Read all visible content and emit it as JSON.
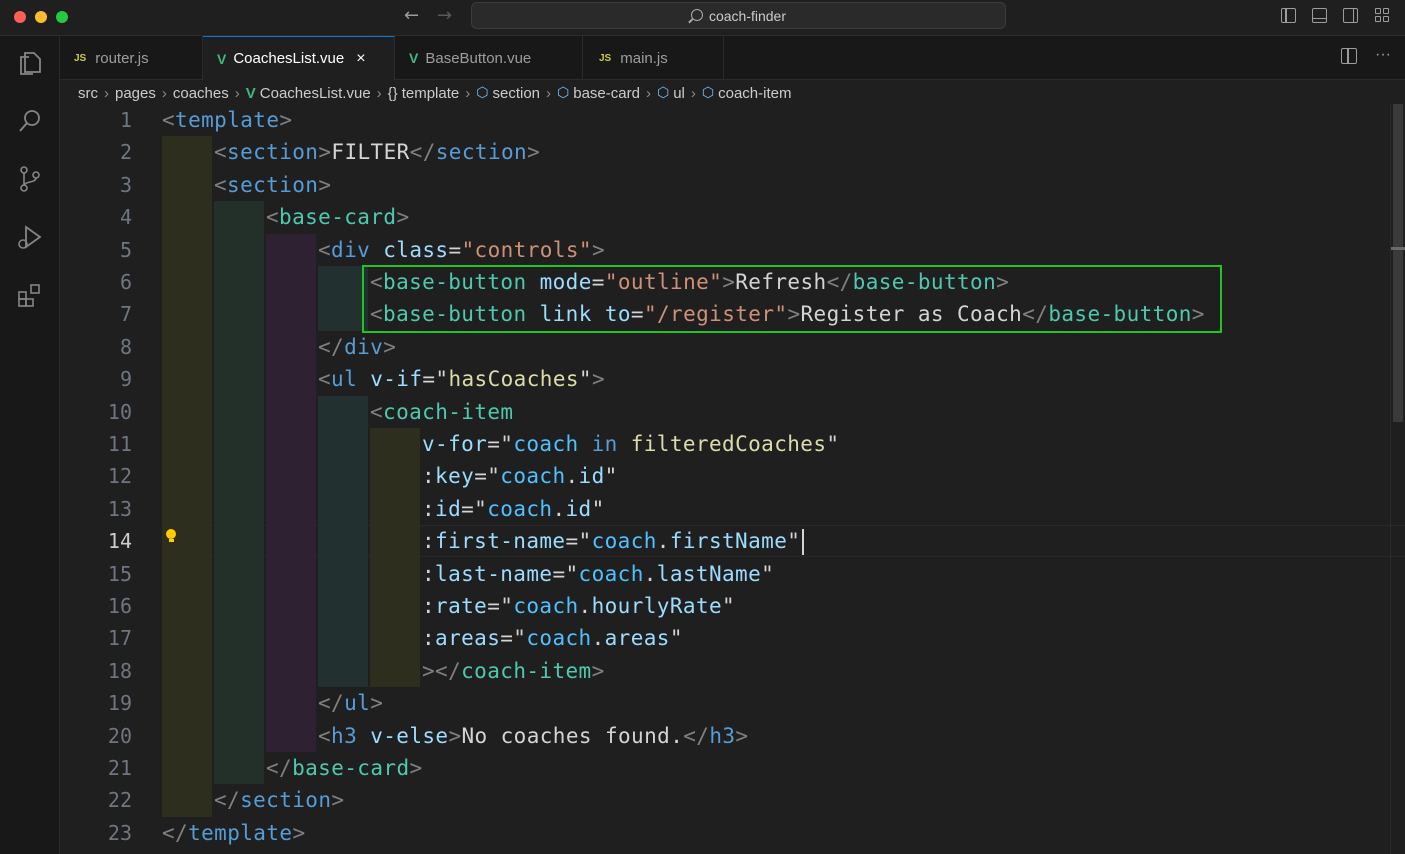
{
  "window": {
    "search_label": "coach-finder",
    "nav_back": "←",
    "nav_forward": "→"
  },
  "tabs": [
    {
      "icon": "JS",
      "label": "router.js"
    },
    {
      "icon": "V",
      "label": "CoachesList.vue",
      "active": true,
      "close": "×"
    },
    {
      "icon": "V",
      "label": "BaseButton.vue"
    },
    {
      "icon": "JS",
      "label": "main.js"
    }
  ],
  "tab_actions": {
    "more": "···"
  },
  "breadcrumb": [
    "src",
    "pages",
    "coaches",
    "CoachesList.vue",
    "template",
    "section",
    "base-card",
    "ul",
    "coach-item"
  ],
  "breadcrumb_template_icon": "{}",
  "editor": {
    "line_numbers": [
      "1",
      "2",
      "3",
      "4",
      "5",
      "6",
      "7",
      "8",
      "9",
      "10",
      "11",
      "12",
      "13",
      "14",
      "15",
      "16",
      "17",
      "18",
      "19",
      "20",
      "21",
      "22",
      "23"
    ],
    "current_line": "14",
    "lines": [
      [
        [
          "p",
          "<"
        ],
        [
          "t",
          "template"
        ],
        [
          "p",
          ">"
        ]
      ],
      [
        [
          "p",
          "<"
        ],
        [
          "t",
          "section"
        ],
        [
          "p",
          ">"
        ],
        [
          "x",
          "FILTER"
        ],
        [
          "p",
          "</"
        ],
        [
          "t",
          "section"
        ],
        [
          "p",
          ">"
        ]
      ],
      [
        [
          "p",
          "<"
        ],
        [
          "t",
          "section"
        ],
        [
          "p",
          ">"
        ]
      ],
      [
        [
          "p",
          "<"
        ],
        [
          "c",
          "base-card"
        ],
        [
          "p",
          ">"
        ]
      ],
      [
        [
          "p",
          "<"
        ],
        [
          "t",
          "div"
        ],
        [
          "x",
          " "
        ],
        [
          "a",
          "class"
        ],
        [
          "x",
          "="
        ],
        [
          "s",
          "\"controls\""
        ],
        [
          "p",
          ">"
        ]
      ],
      [
        [
          "p",
          "<"
        ],
        [
          "c",
          "base-button"
        ],
        [
          "x",
          " "
        ],
        [
          "a",
          "mode"
        ],
        [
          "x",
          "="
        ],
        [
          "s",
          "\"outline\""
        ],
        [
          "p",
          ">"
        ],
        [
          "x",
          "Refresh"
        ],
        [
          "p",
          "</"
        ],
        [
          "c",
          "base-button"
        ],
        [
          "p",
          ">"
        ]
      ],
      [
        [
          "p",
          "<"
        ],
        [
          "c",
          "base-button"
        ],
        [
          "x",
          " "
        ],
        [
          "a",
          "link"
        ],
        [
          "x",
          " "
        ],
        [
          "a",
          "to"
        ],
        [
          "x",
          "="
        ],
        [
          "s",
          "\"/register\""
        ],
        [
          "p",
          ">"
        ],
        [
          "x",
          "Register as Coach"
        ],
        [
          "p",
          "</"
        ],
        [
          "c",
          "base-button"
        ],
        [
          "p",
          ">"
        ]
      ],
      [
        [
          "p",
          "</"
        ],
        [
          "t",
          "div"
        ],
        [
          "p",
          ">"
        ]
      ],
      [
        [
          "p",
          "<"
        ],
        [
          "t",
          "ul"
        ],
        [
          "x",
          " "
        ],
        [
          "a",
          "v-if"
        ],
        [
          "x",
          "="
        ],
        [
          "x",
          "\""
        ],
        [
          "y",
          "hasCoaches"
        ],
        [
          "x",
          "\""
        ],
        [
          "p",
          ">"
        ]
      ],
      [
        [
          "p",
          "<"
        ],
        [
          "c",
          "coach-item"
        ]
      ],
      [
        [
          "a",
          "v-for"
        ],
        [
          "x",
          "=\""
        ],
        [
          "v",
          "coach"
        ],
        [
          "x",
          " "
        ],
        [
          "kw",
          "in"
        ],
        [
          "x",
          " "
        ],
        [
          "y",
          "filteredCoaches"
        ],
        [
          "x",
          "\""
        ]
      ],
      [
        [
          "x",
          ":"
        ],
        [
          "a",
          "key"
        ],
        [
          "x",
          "=\""
        ],
        [
          "v",
          "coach"
        ],
        [
          "x",
          "."
        ],
        [
          "a",
          "id"
        ],
        [
          "x",
          "\""
        ]
      ],
      [
        [
          "x",
          ":"
        ],
        [
          "a",
          "id"
        ],
        [
          "x",
          "=\""
        ],
        [
          "v",
          "coach"
        ],
        [
          "x",
          "."
        ],
        [
          "a",
          "id"
        ],
        [
          "x",
          "\""
        ]
      ],
      [
        [
          "x",
          ":"
        ],
        [
          "a",
          "first-name"
        ],
        [
          "x",
          "=\""
        ],
        [
          "v",
          "coach"
        ],
        [
          "x",
          "."
        ],
        [
          "a",
          "firstName"
        ],
        [
          "x",
          "\""
        ]
      ],
      [
        [
          "x",
          ":"
        ],
        [
          "a",
          "last-name"
        ],
        [
          "x",
          "=\""
        ],
        [
          "v",
          "coach"
        ],
        [
          "x",
          "."
        ],
        [
          "a",
          "lastName"
        ],
        [
          "x",
          "\""
        ]
      ],
      [
        [
          "x",
          ":"
        ],
        [
          "a",
          "rate"
        ],
        [
          "x",
          "=\""
        ],
        [
          "v",
          "coach"
        ],
        [
          "x",
          "."
        ],
        [
          "a",
          "hourlyRate"
        ],
        [
          "x",
          "\""
        ]
      ],
      [
        [
          "x",
          ":"
        ],
        [
          "a",
          "areas"
        ],
        [
          "x",
          "=\""
        ],
        [
          "v",
          "coach"
        ],
        [
          "x",
          "."
        ],
        [
          "a",
          "areas"
        ],
        [
          "x",
          "\""
        ]
      ],
      [
        [
          "p",
          "></"
        ],
        [
          "c",
          "coach-item"
        ],
        [
          "p",
          ">"
        ]
      ],
      [
        [
          "p",
          "</"
        ],
        [
          "t",
          "ul"
        ],
        [
          "p",
          ">"
        ]
      ],
      [
        [
          "p",
          "<"
        ],
        [
          "t",
          "h3"
        ],
        [
          "x",
          " "
        ],
        [
          "a",
          "v-else"
        ],
        [
          "p",
          ">"
        ],
        [
          "x",
          "No coaches found."
        ],
        [
          "p",
          "</"
        ],
        [
          "t",
          "h3"
        ],
        [
          "p",
          ">"
        ]
      ],
      [
        [
          "p",
          "</"
        ],
        [
          "c",
          "base-card"
        ],
        [
          "p",
          ">"
        ]
      ],
      [
        [
          "p",
          "</"
        ],
        [
          "t",
          "section"
        ],
        [
          "p",
          ">"
        ]
      ],
      [
        [
          "p",
          "</"
        ],
        [
          "t",
          "template"
        ],
        [
          "p",
          ">"
        ]
      ]
    ]
  },
  "colors": {
    "accent": "#0078d4",
    "highlight_box": "#22c322",
    "indent_guides": [
      "#2e2e1f",
      "#23302a",
      "#2e2232",
      "#233030",
      "#2e2e1f"
    ]
  }
}
